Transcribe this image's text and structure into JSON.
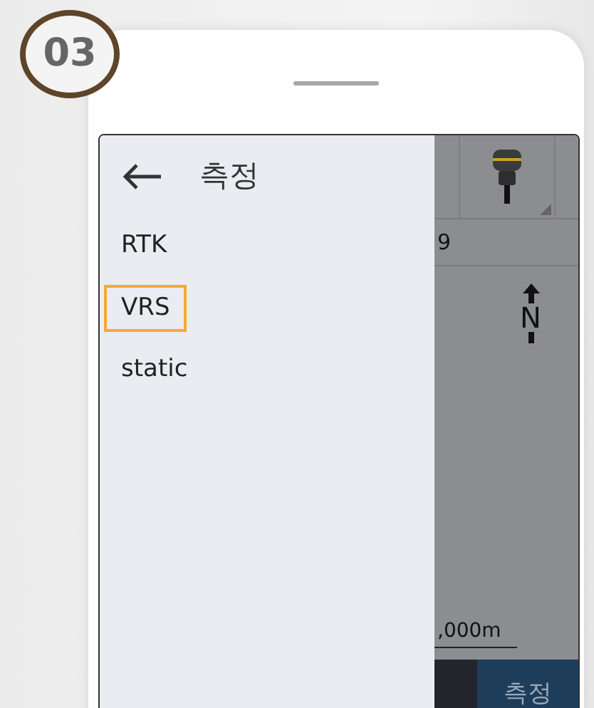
{
  "step_badge": "03",
  "drawer": {
    "title": "측정",
    "items": [
      {
        "label": "RTK",
        "selected": false
      },
      {
        "label": "VRS",
        "selected": true
      },
      {
        "label": "static",
        "selected": false
      }
    ]
  },
  "map": {
    "status_value": "9",
    "north_label": "N",
    "scale_label": ",000m",
    "action_button": "측정"
  }
}
